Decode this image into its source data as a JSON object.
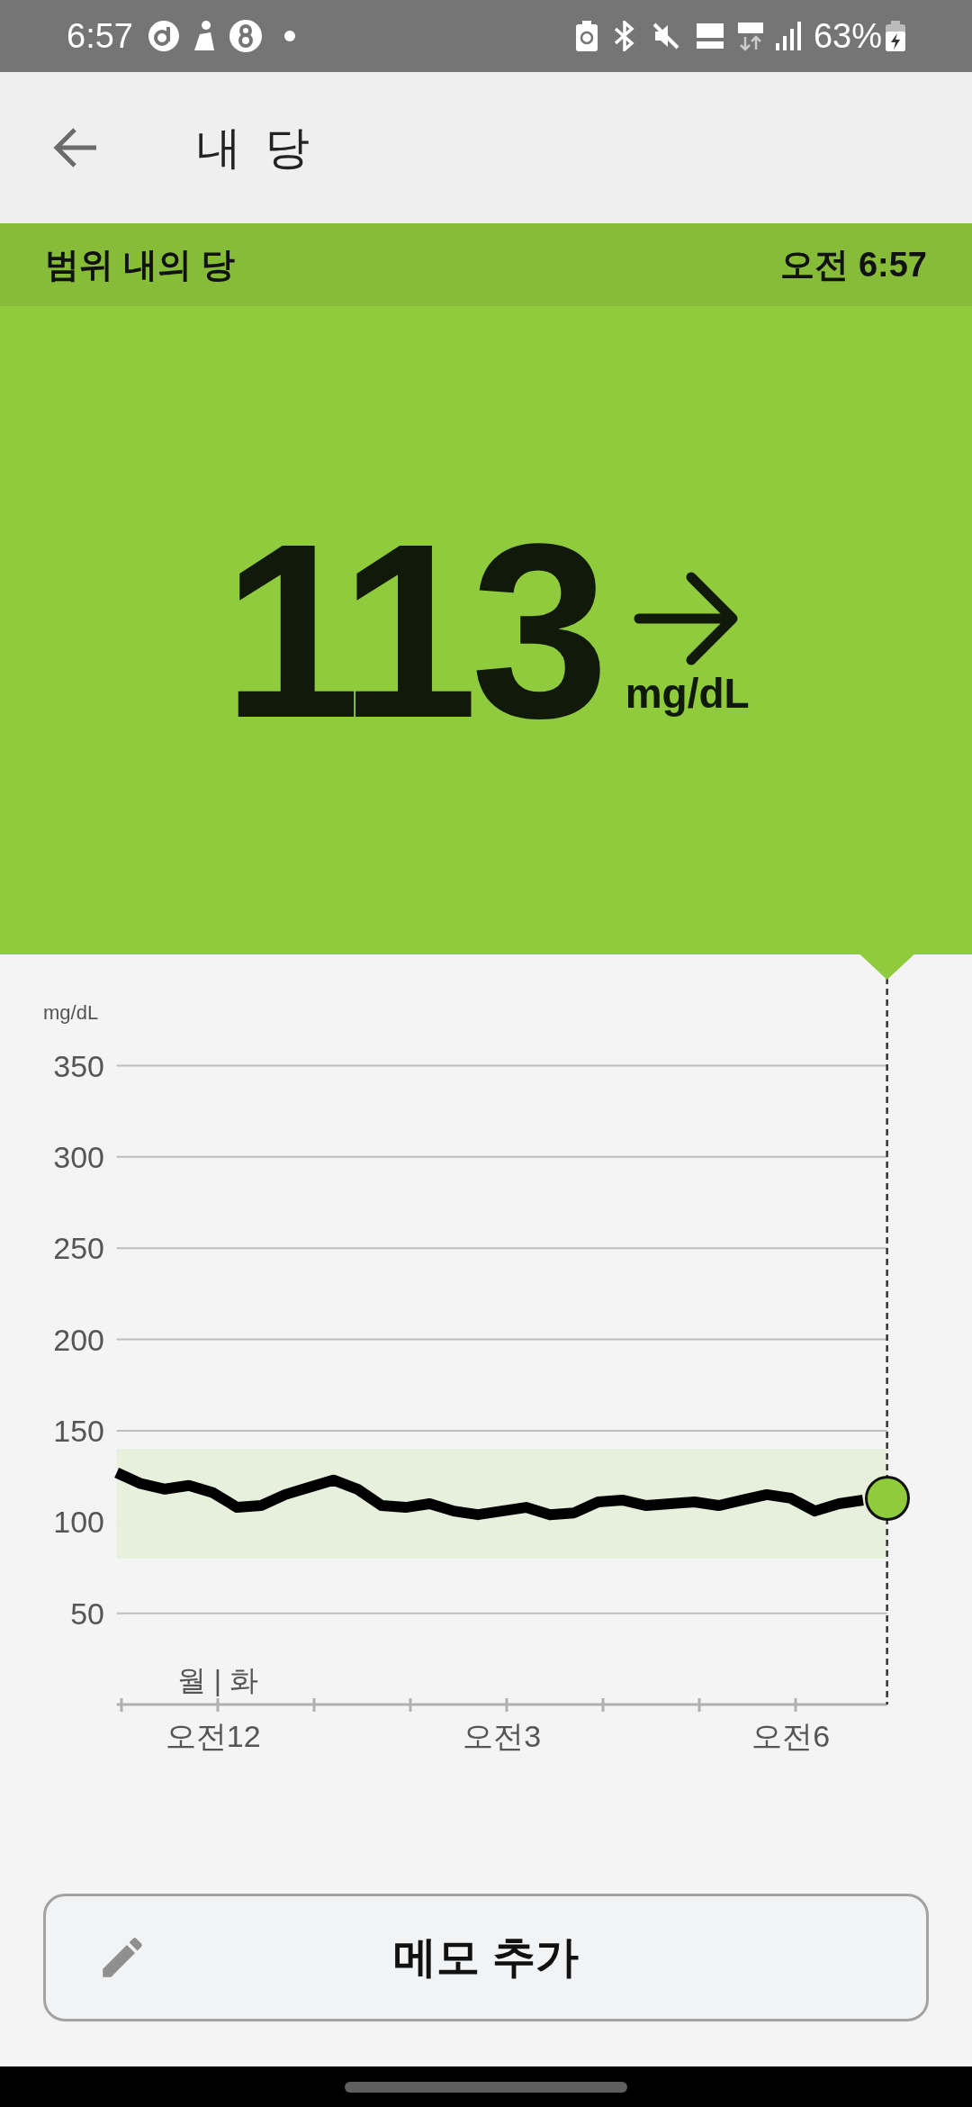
{
  "status_bar": {
    "time": "6:57",
    "battery": "63%"
  },
  "header": {
    "title": "내 당"
  },
  "status_strip": {
    "label": "범위 내의 당",
    "time": "오전 6:57"
  },
  "reading": {
    "value": "113",
    "unit": "mg/dL"
  },
  "chart": {
    "day_label": "월 | 화",
    "chart_data": {
      "type": "line",
      "ylabel": "mg/dL",
      "ylim": [
        0,
        350
      ],
      "yticks": [
        50,
        100,
        150,
        200,
        250,
        300,
        350
      ],
      "categories": [
        null,
        null,
        null,
        null,
        "오전12",
        null,
        null,
        null,
        null,
        null,
        null,
        null,
        null,
        null,
        null,
        null,
        "오전3",
        null,
        null,
        null,
        null,
        null,
        null,
        null,
        null,
        null,
        null,
        null,
        "오전6",
        null,
        null,
        null,
        null
      ],
      "grid": true,
      "series": [
        {
          "color": "#000000",
          "values": [
            127,
            121,
            118,
            120,
            116,
            108,
            109,
            115,
            119,
            123,
            118,
            109,
            108,
            110,
            106,
            104,
            106,
            108,
            104,
            105,
            111,
            112,
            109,
            110,
            111,
            109,
            112,
            115,
            113,
            106,
            110,
            112,
            null
          ]
        }
      ],
      "bands": [
        {
          "axis": "y",
          "from": 80,
          "to": 140
        }
      ]
    }
  },
  "memo_button": {
    "label": "메모 추가"
  }
}
